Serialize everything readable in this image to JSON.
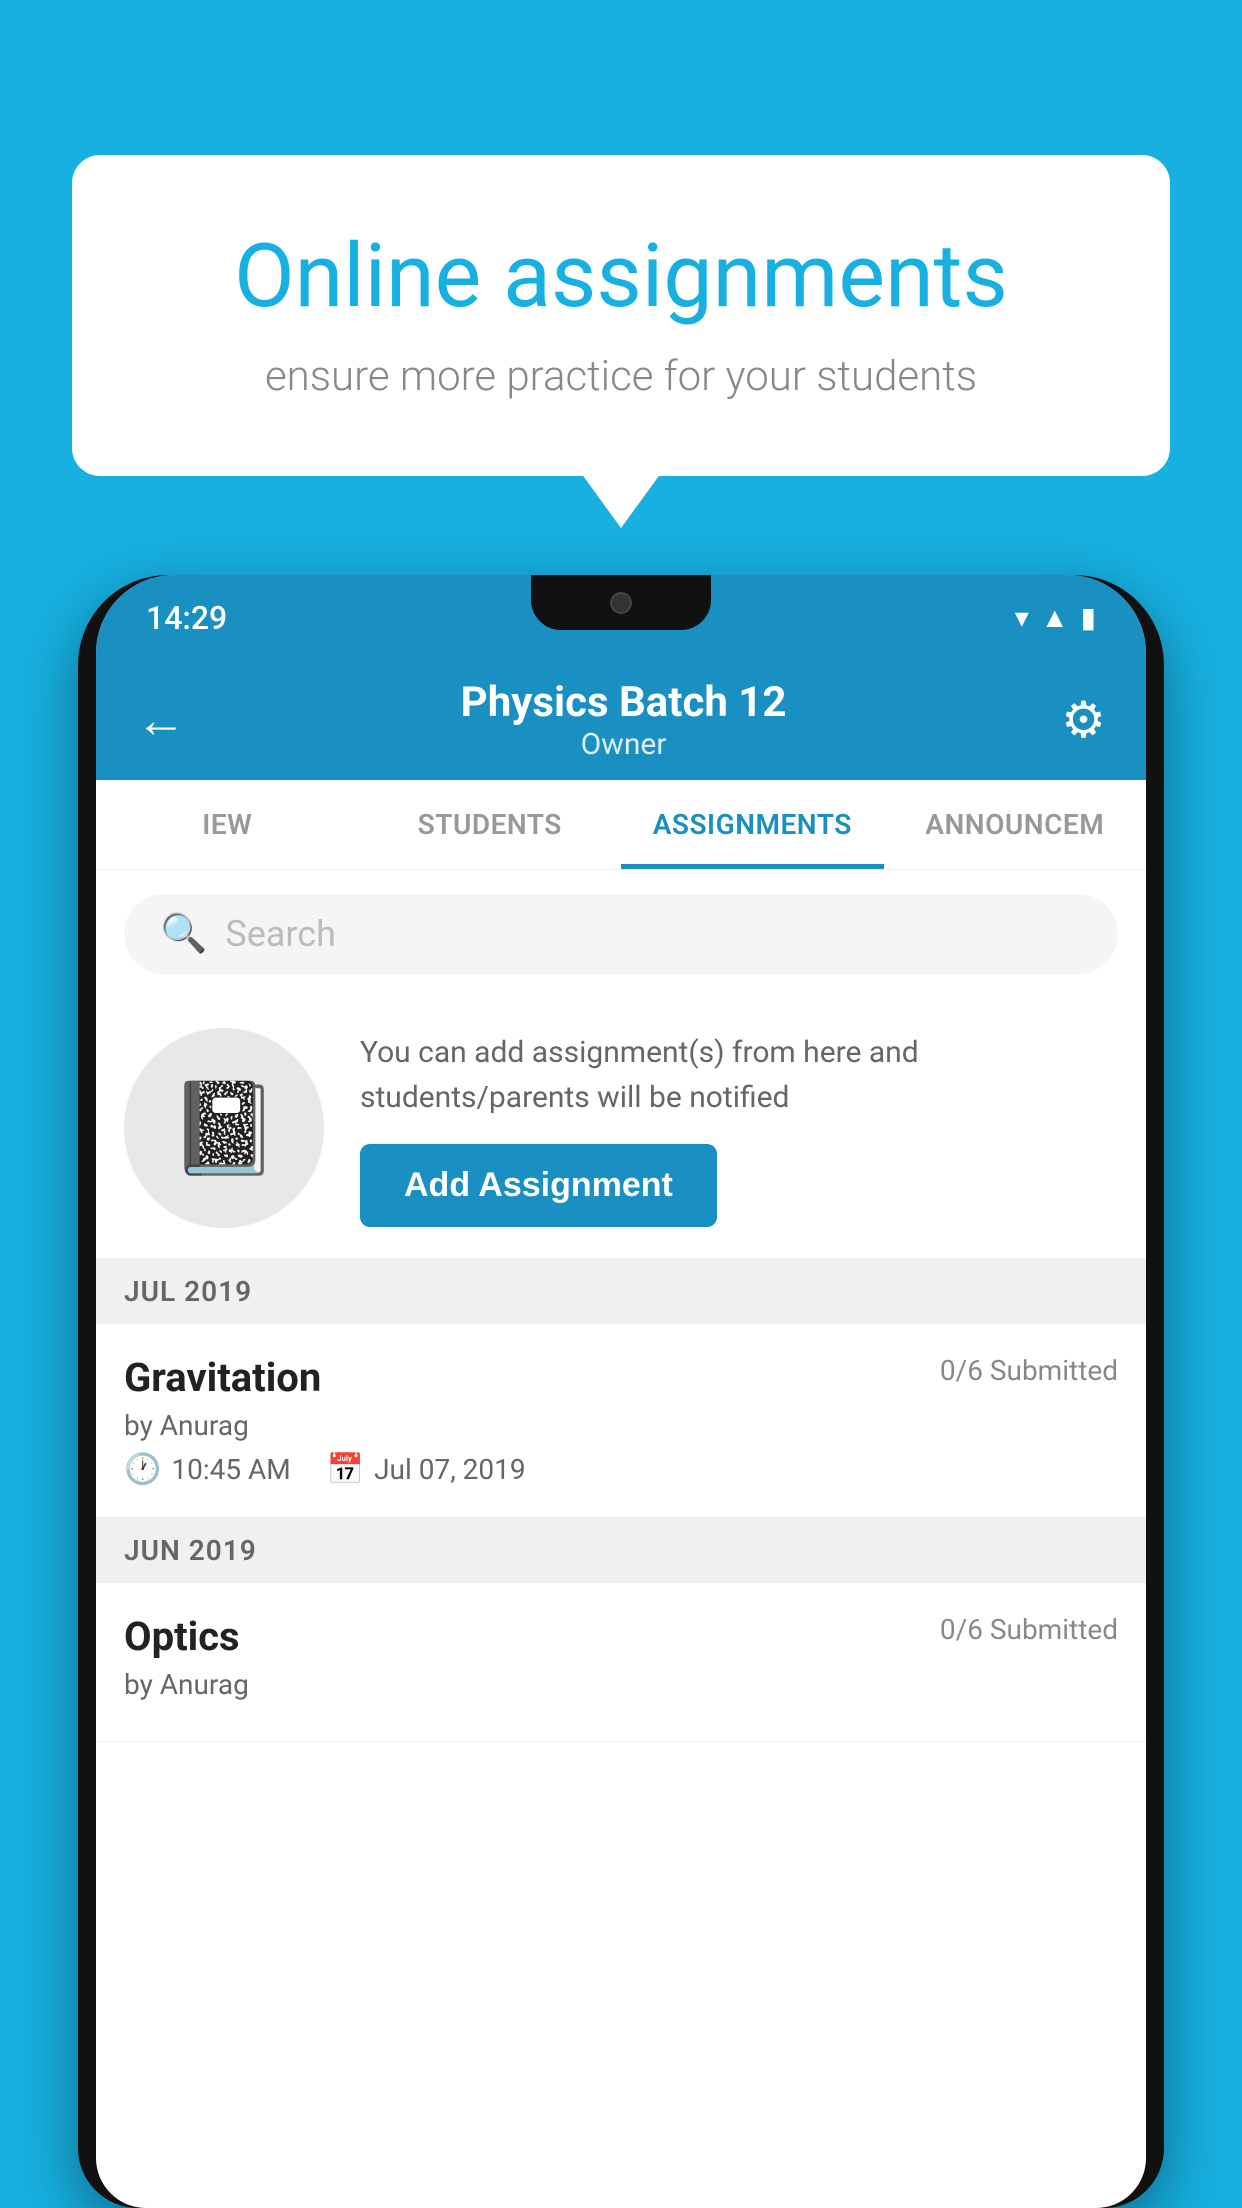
{
  "background": {
    "color": "#17b0e0"
  },
  "speech_bubble": {
    "title": "Online assignments",
    "subtitle": "ensure more practice for your students"
  },
  "phone": {
    "status_bar": {
      "time": "14:29",
      "wifi": "▾",
      "signal": "▲",
      "battery": "▮"
    },
    "header": {
      "title": "Physics Batch 12",
      "subtitle": "Owner",
      "back_label": "←",
      "settings_label": "⚙"
    },
    "tabs": [
      {
        "label": "IEW",
        "active": false
      },
      {
        "label": "STUDENTS",
        "active": false
      },
      {
        "label": "ASSIGNMENTS",
        "active": true
      },
      {
        "label": "ANNOUNCEM",
        "active": false
      }
    ],
    "search": {
      "placeholder": "Search"
    },
    "promo": {
      "description": "You can add assignment(s) from here and students/parents will be notified",
      "button_label": "Add Assignment"
    },
    "sections": [
      {
        "month_label": "JUL 2019",
        "assignments": [
          {
            "title": "Gravitation",
            "submitted": "0/6 Submitted",
            "author": "by Anurag",
            "time": "10:45 AM",
            "date": "Jul 07, 2019"
          }
        ]
      },
      {
        "month_label": "JUN 2019",
        "assignments": [
          {
            "title": "Optics",
            "submitted": "0/6 Submitted",
            "author": "by Anurag",
            "time": "",
            "date": ""
          }
        ]
      }
    ]
  }
}
